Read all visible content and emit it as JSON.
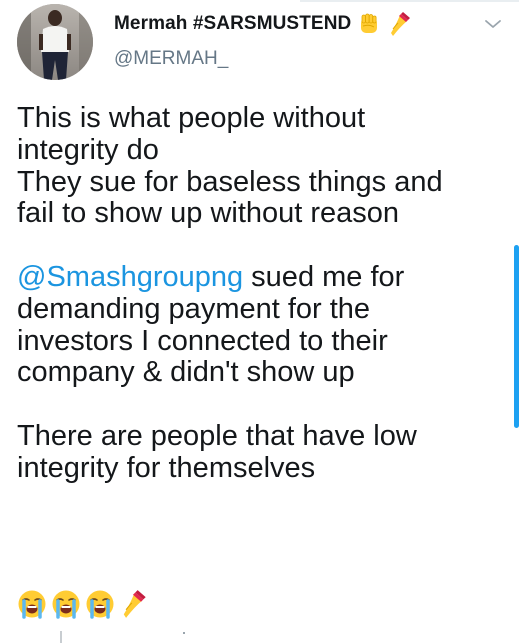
{
  "tweet": {
    "author": {
      "display_name": "Mermah #SARSMUSTEND",
      "name_emojis": [
        "raised-fist-emoji",
        "nail-polish-emoji"
      ],
      "handle": "@MERMAH_"
    },
    "body": {
      "line_1": "This is what people without",
      "line_2": "integrity do",
      "line_3": "They sue for baseless things and",
      "line_4": "fail to show up without reason",
      "mention": "@Smashgroupng",
      "line_5_rest": " sued me for",
      "line_6": "demanding payment for the",
      "line_7": "investors I connected to their",
      "line_8": "company & didn't show up",
      "line_9": "There are people that have low",
      "line_10": "integrity for themselves",
      "trailing_emojis": [
        "crying-face-emoji",
        "crying-face-emoji",
        "crying-face-emoji",
        "nail-polish-emoji"
      ]
    },
    "menu_icon": "chevron-down-icon"
  },
  "colors": {
    "text": "#14171a",
    "secondary_text": "#657786",
    "mention": "#1b95e0",
    "accent": "#1da1f2"
  }
}
